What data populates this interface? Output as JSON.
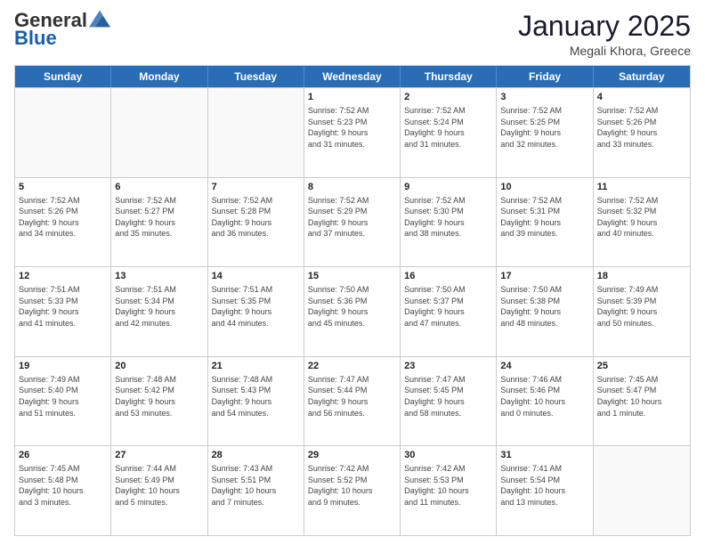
{
  "logo": {
    "general": "General",
    "blue": "Blue"
  },
  "header": {
    "month_title": "January 2025",
    "subtitle": "Megali Khora, Greece"
  },
  "weekdays": [
    "Sunday",
    "Monday",
    "Tuesday",
    "Wednesday",
    "Thursday",
    "Friday",
    "Saturday"
  ],
  "weeks": [
    [
      {
        "day": "",
        "info": "",
        "empty": true
      },
      {
        "day": "",
        "info": "",
        "empty": true
      },
      {
        "day": "",
        "info": "",
        "empty": true
      },
      {
        "day": "1",
        "info": "Sunrise: 7:52 AM\nSunset: 5:23 PM\nDaylight: 9 hours\nand 31 minutes."
      },
      {
        "day": "2",
        "info": "Sunrise: 7:52 AM\nSunset: 5:24 PM\nDaylight: 9 hours\nand 31 minutes."
      },
      {
        "day": "3",
        "info": "Sunrise: 7:52 AM\nSunset: 5:25 PM\nDaylight: 9 hours\nand 32 minutes."
      },
      {
        "day": "4",
        "info": "Sunrise: 7:52 AM\nSunset: 5:26 PM\nDaylight: 9 hours\nand 33 minutes."
      }
    ],
    [
      {
        "day": "5",
        "info": "Sunrise: 7:52 AM\nSunset: 5:26 PM\nDaylight: 9 hours\nand 34 minutes."
      },
      {
        "day": "6",
        "info": "Sunrise: 7:52 AM\nSunset: 5:27 PM\nDaylight: 9 hours\nand 35 minutes."
      },
      {
        "day": "7",
        "info": "Sunrise: 7:52 AM\nSunset: 5:28 PM\nDaylight: 9 hours\nand 36 minutes."
      },
      {
        "day": "8",
        "info": "Sunrise: 7:52 AM\nSunset: 5:29 PM\nDaylight: 9 hours\nand 37 minutes."
      },
      {
        "day": "9",
        "info": "Sunrise: 7:52 AM\nSunset: 5:30 PM\nDaylight: 9 hours\nand 38 minutes."
      },
      {
        "day": "10",
        "info": "Sunrise: 7:52 AM\nSunset: 5:31 PM\nDaylight: 9 hours\nand 39 minutes."
      },
      {
        "day": "11",
        "info": "Sunrise: 7:52 AM\nSunset: 5:32 PM\nDaylight: 9 hours\nand 40 minutes."
      }
    ],
    [
      {
        "day": "12",
        "info": "Sunrise: 7:51 AM\nSunset: 5:33 PM\nDaylight: 9 hours\nand 41 minutes."
      },
      {
        "day": "13",
        "info": "Sunrise: 7:51 AM\nSunset: 5:34 PM\nDaylight: 9 hours\nand 42 minutes."
      },
      {
        "day": "14",
        "info": "Sunrise: 7:51 AM\nSunset: 5:35 PM\nDaylight: 9 hours\nand 44 minutes."
      },
      {
        "day": "15",
        "info": "Sunrise: 7:50 AM\nSunset: 5:36 PM\nDaylight: 9 hours\nand 45 minutes."
      },
      {
        "day": "16",
        "info": "Sunrise: 7:50 AM\nSunset: 5:37 PM\nDaylight: 9 hours\nand 47 minutes."
      },
      {
        "day": "17",
        "info": "Sunrise: 7:50 AM\nSunset: 5:38 PM\nDaylight: 9 hours\nand 48 minutes."
      },
      {
        "day": "18",
        "info": "Sunrise: 7:49 AM\nSunset: 5:39 PM\nDaylight: 9 hours\nand 50 minutes."
      }
    ],
    [
      {
        "day": "19",
        "info": "Sunrise: 7:49 AM\nSunset: 5:40 PM\nDaylight: 9 hours\nand 51 minutes."
      },
      {
        "day": "20",
        "info": "Sunrise: 7:48 AM\nSunset: 5:42 PM\nDaylight: 9 hours\nand 53 minutes."
      },
      {
        "day": "21",
        "info": "Sunrise: 7:48 AM\nSunset: 5:43 PM\nDaylight: 9 hours\nand 54 minutes."
      },
      {
        "day": "22",
        "info": "Sunrise: 7:47 AM\nSunset: 5:44 PM\nDaylight: 9 hours\nand 56 minutes."
      },
      {
        "day": "23",
        "info": "Sunrise: 7:47 AM\nSunset: 5:45 PM\nDaylight: 9 hours\nand 58 minutes."
      },
      {
        "day": "24",
        "info": "Sunrise: 7:46 AM\nSunset: 5:46 PM\nDaylight: 10 hours\nand 0 minutes."
      },
      {
        "day": "25",
        "info": "Sunrise: 7:45 AM\nSunset: 5:47 PM\nDaylight: 10 hours\nand 1 minute."
      }
    ],
    [
      {
        "day": "26",
        "info": "Sunrise: 7:45 AM\nSunset: 5:48 PM\nDaylight: 10 hours\nand 3 minutes."
      },
      {
        "day": "27",
        "info": "Sunrise: 7:44 AM\nSunset: 5:49 PM\nDaylight: 10 hours\nand 5 minutes."
      },
      {
        "day": "28",
        "info": "Sunrise: 7:43 AM\nSunset: 5:51 PM\nDaylight: 10 hours\nand 7 minutes."
      },
      {
        "day": "29",
        "info": "Sunrise: 7:42 AM\nSunset: 5:52 PM\nDaylight: 10 hours\nand 9 minutes."
      },
      {
        "day": "30",
        "info": "Sunrise: 7:42 AM\nSunset: 5:53 PM\nDaylight: 10 hours\nand 11 minutes."
      },
      {
        "day": "31",
        "info": "Sunrise: 7:41 AM\nSunset: 5:54 PM\nDaylight: 10 hours\nand 13 minutes."
      },
      {
        "day": "",
        "info": "",
        "empty": true
      }
    ]
  ]
}
